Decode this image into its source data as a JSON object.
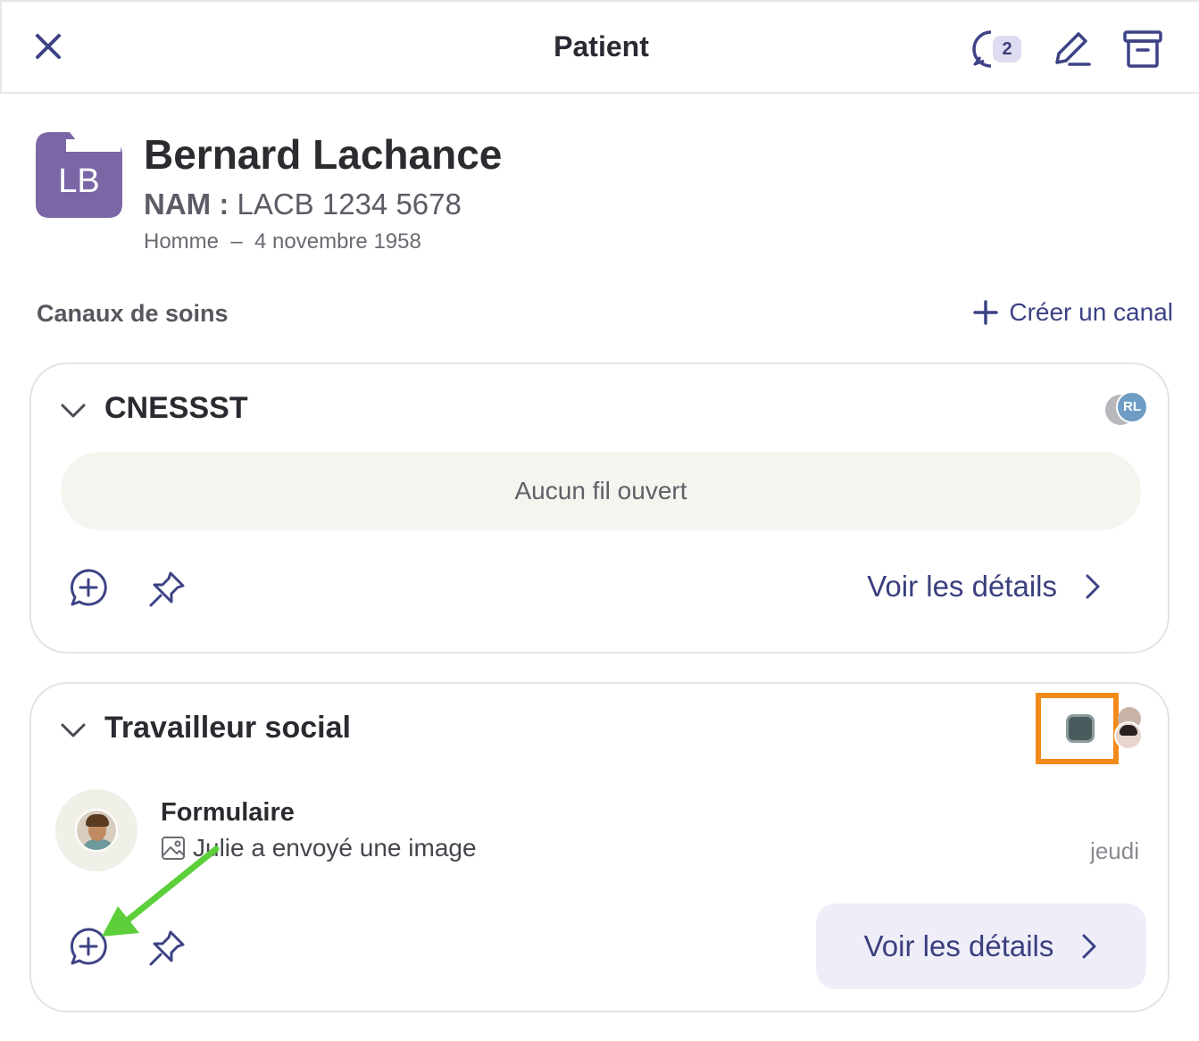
{
  "header": {
    "title": "Patient",
    "notifications_count": "2"
  },
  "patient": {
    "initials": "LB",
    "name": "Bernard Lachance",
    "nam_label": "NAM :",
    "nam_value": "LACB 1234 5678",
    "meta": "Homme  –  4 novembre 1958",
    "avatar_color": "#7b67a6"
  },
  "care_channels": {
    "label": "Canaux de soins",
    "create_label": "Créer un canal"
  },
  "channels": [
    {
      "title": "CNESSST",
      "empty_text": "Aucun fil ouvert",
      "details_label": "Voir les détails",
      "member_initials": "RL"
    },
    {
      "title": "Travailleur social",
      "thread": {
        "title": "Formulaire",
        "preview": "Julie a envoyé une image",
        "time": "jeudi"
      },
      "details_label": "Voir les détails"
    }
  ],
  "colors": {
    "accent": "#3d4285",
    "highlight_box": "#f28a1a",
    "annotation_arrow": "#5ccf3a"
  }
}
